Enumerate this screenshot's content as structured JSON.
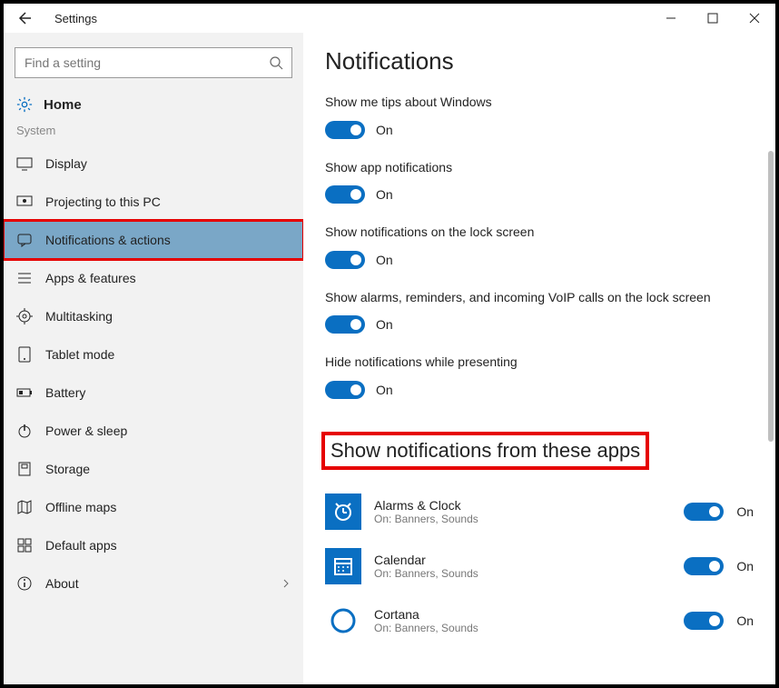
{
  "titlebar": {
    "title": "Settings"
  },
  "search": {
    "placeholder": "Find a setting"
  },
  "home_label": "Home",
  "section_label": "System",
  "nav": [
    {
      "label": "Display"
    },
    {
      "label": "Projecting to this PC"
    },
    {
      "label": "Notifications & actions"
    },
    {
      "label": "Apps & features"
    },
    {
      "label": "Multitasking"
    },
    {
      "label": "Tablet mode"
    },
    {
      "label": "Battery"
    },
    {
      "label": "Power & sleep"
    },
    {
      "label": "Storage"
    },
    {
      "label": "Offline maps"
    },
    {
      "label": "Default apps"
    },
    {
      "label": "About"
    }
  ],
  "page_title": "Notifications",
  "settings": [
    {
      "label": "Show me tips about Windows",
      "state": "On"
    },
    {
      "label": "Show app notifications",
      "state": "On"
    },
    {
      "label": "Show notifications on the lock screen",
      "state": "On"
    },
    {
      "label": "Show alarms, reminders, and incoming VoIP calls on the lock screen",
      "state": "On"
    },
    {
      "label": "Hide notifications while presenting",
      "state": "On"
    }
  ],
  "apps_heading": "Show notifications from these apps",
  "apps": [
    {
      "name": "Alarms & Clock",
      "sub": "On: Banners, Sounds",
      "state": "On"
    },
    {
      "name": "Calendar",
      "sub": "On: Banners, Sounds",
      "state": "On"
    },
    {
      "name": "Cortana",
      "sub": "On: Banners, Sounds",
      "state": "On"
    }
  ]
}
